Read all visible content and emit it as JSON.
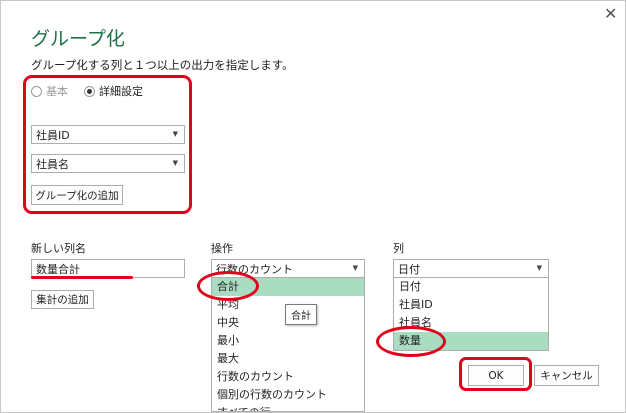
{
  "dialog": {
    "title": "グループ化",
    "description": "グループ化する列と１つ以上の出力を指定します。",
    "close_glyph": "✕"
  },
  "mode": {
    "basic_label": "基本",
    "advanced_label": "詳細設定",
    "selected": "advanced"
  },
  "group_by": {
    "fields": [
      {
        "value": "社員ID"
      },
      {
        "value": "社員名"
      }
    ],
    "add_button": "グループ化の追加"
  },
  "aggregation": {
    "new_column_label": "新しい列名",
    "new_column_value": "数量合計",
    "operation_label": "操作",
    "operation_value": "行数のカウント",
    "column_label": "列",
    "column_value": "日付",
    "add_aggregation_button": "集計の追加"
  },
  "operation_list": {
    "items": [
      "合計",
      "平均",
      "中央",
      "最小",
      "最大",
      "行数のカウント",
      "個別の行数のカウント",
      "すべての行"
    ],
    "selected_index": 0,
    "tooltip": "合計"
  },
  "column_list": {
    "items": [
      "日付",
      "社員ID",
      "社員名",
      "数量"
    ],
    "selected_index": 3
  },
  "footer": {
    "ok_label": "OK",
    "cancel_label": "キャンセル"
  },
  "colors": {
    "title_green": "#1e7145",
    "selection_green": "#a9dcc1",
    "annotation_red": "#e3001b"
  },
  "icons": {
    "dropdown": "chevron-down-icon",
    "close": "close-icon"
  }
}
